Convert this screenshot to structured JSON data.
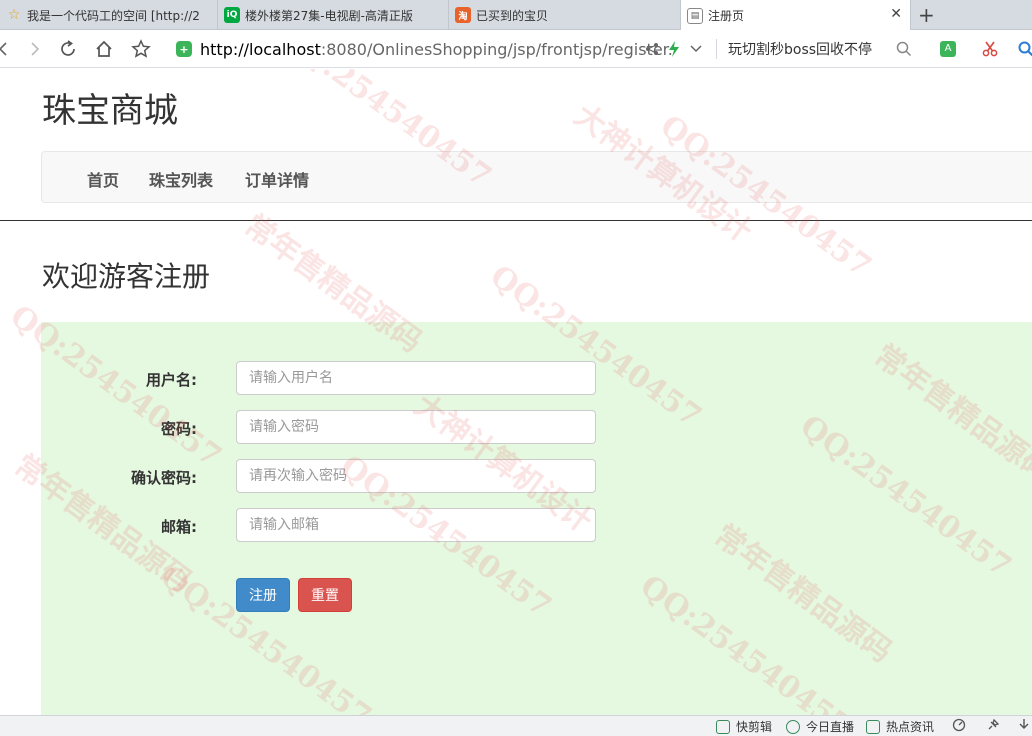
{
  "browser": {
    "tabs": [
      {
        "title": "我是一个代码工的空间 [http://2",
        "icon": "star-icon"
      },
      {
        "title": "楼外楼第27集-电视剧-高清正版",
        "icon": "iqiyi-icon"
      },
      {
        "title": "已买到的宝贝",
        "icon": "taobao-icon"
      },
      {
        "title": "注册页",
        "icon": "page-icon",
        "active": true
      }
    ],
    "url_host": "http://localhost",
    "url_rest": ":8080/OnlinesShopping/jsp/frontjsp/register.",
    "search_text": "玩切割秒boss回收不停"
  },
  "site": {
    "title": "珠宝商城",
    "nav": [
      "首页",
      "珠宝列表",
      "订单详情"
    ]
  },
  "register": {
    "heading": "欢迎游客注册",
    "fields": [
      {
        "label": "用户名:",
        "placeholder": "请输入用户名"
      },
      {
        "label": "密码:",
        "placeholder": "请输入密码"
      },
      {
        "label": "确认密码:",
        "placeholder": "请再次输入密码"
      },
      {
        "label": "邮箱:",
        "placeholder": "请输入邮箱"
      }
    ],
    "submit_label": "注册",
    "reset_label": "重置"
  },
  "statusbar": {
    "items": [
      "快剪辑",
      "今日直播",
      "热点资讯"
    ]
  },
  "watermark": {
    "texts": [
      "QQ:254540457",
      "大神计算机设计",
      "常年售精品源码"
    ]
  },
  "colors": {
    "primary": "#428bca",
    "danger": "#d9534f",
    "form_bg": "#e5f8e0"
  }
}
